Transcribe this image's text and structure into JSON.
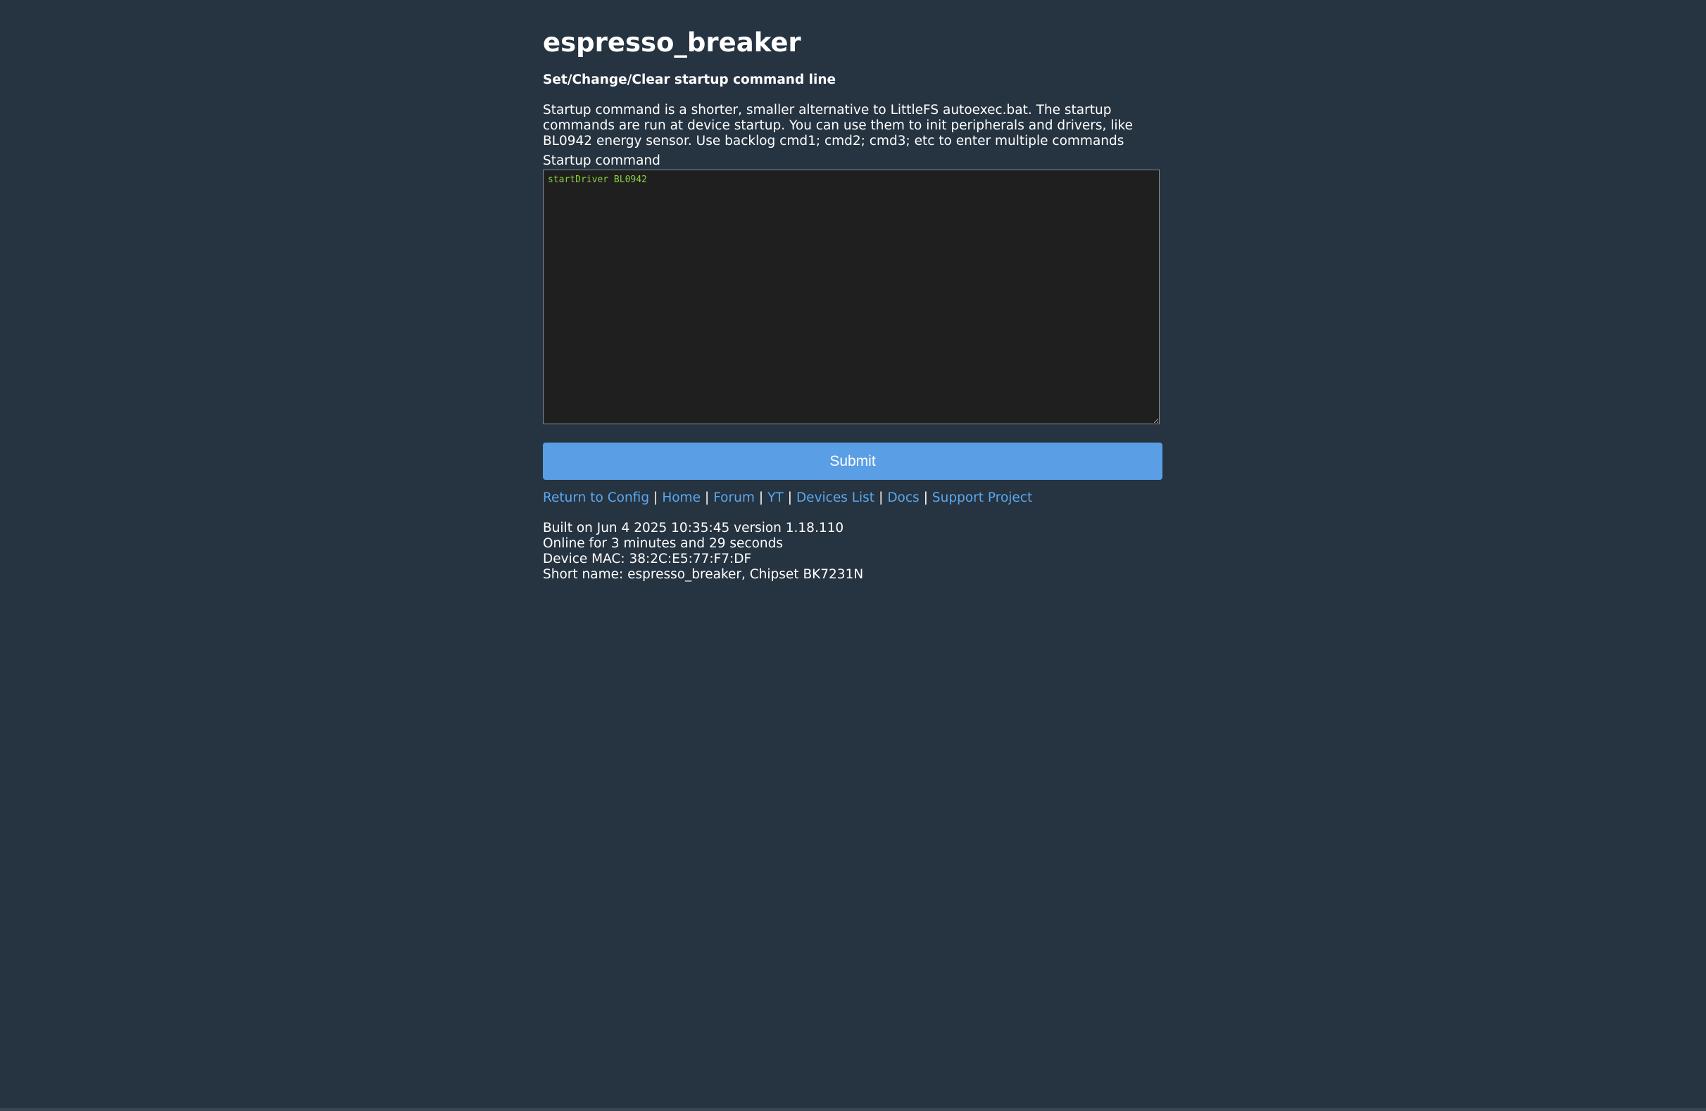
{
  "device_name": "espresso_breaker",
  "section_title": "Set/Change/Clear startup command line",
  "description": "Startup command is a shorter, smaller alternative to LittleFS autoexec.bat. The startup commands are run at device startup. You can use them to init peripherals and drivers, like BL0942 energy sensor. Use backlog cmd1; cmd2; cmd3; etc to enter multiple commands",
  "form": {
    "label": "Startup command",
    "value": "startDriver BL0942",
    "submit_label": "Submit"
  },
  "nav": {
    "links": [
      "Return to Config",
      "Home",
      "Forum",
      "YT",
      "Devices List",
      "Docs",
      "Support Project"
    ],
    "separator": "|"
  },
  "info": {
    "built": "Built on Jun 4 2025 10:35:45 version 1.18.110",
    "online": "Online for 3 minutes and 29 seconds",
    "mac": "Device MAC: 38:2C:E5:77:F7:DF",
    "short_name": "Short name: espresso_breaker, Chipset BK7231N"
  },
  "colors": {
    "background": "#263340",
    "link": "#5aa9f0",
    "button": "#5a9ee5",
    "textarea_bg": "#1f1f1f",
    "textarea_text": "#8bd13e"
  }
}
